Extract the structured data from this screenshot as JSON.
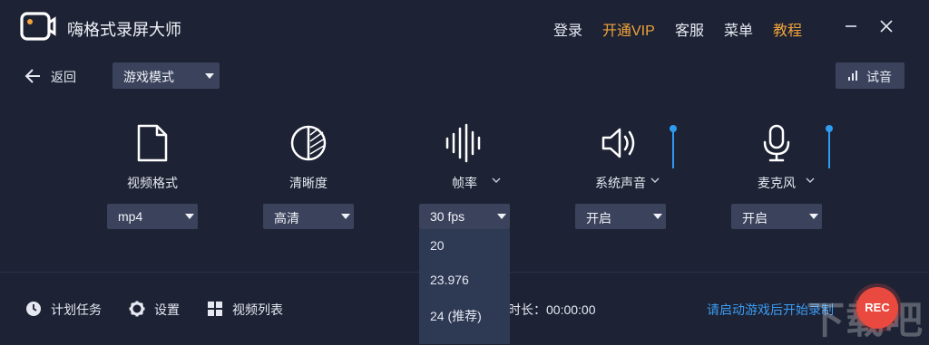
{
  "app": {
    "title": "嗨格式录屏大师"
  },
  "topnav": {
    "login": "登录",
    "vip": "开通VIP",
    "service": "客服",
    "menu": "菜单",
    "tutorial": "教程"
  },
  "colors": {
    "accent_orange": "#f1a43a",
    "accent_blue": "#3b9cf2",
    "rec_red": "#e9493f",
    "background": "#1d2234",
    "control_bg": "#3b435c"
  },
  "toolbar": {
    "back_label": "返回",
    "mode_select": "游戏模式",
    "audio_test": "试音"
  },
  "settings": {
    "video_format": {
      "label": "视频格式",
      "value": "mp4",
      "icon": "file-icon"
    },
    "clarity": {
      "label": "清晰度",
      "value": "高清",
      "icon": "contrast-icon"
    },
    "framerate": {
      "label": "帧率",
      "value": "30 fps",
      "icon": "waveform-icon",
      "options": [
        "20",
        "23.976",
        "24 (推荐)"
      ]
    },
    "system_sound": {
      "label": "系统声音",
      "value": "开启",
      "icon": "speaker-icon",
      "level": 0.9
    },
    "microphone": {
      "label": "麦克风",
      "value": "开启",
      "icon": "microphone-icon",
      "level": 0.9
    }
  },
  "bottom": {
    "schedule": "计划任务",
    "settings": "设置",
    "video_list": "视频列表",
    "duration": "时长：00:00:00",
    "hint": "请启动游戏后开始录制",
    "rec": "REC"
  },
  "watermark": "下载吧"
}
